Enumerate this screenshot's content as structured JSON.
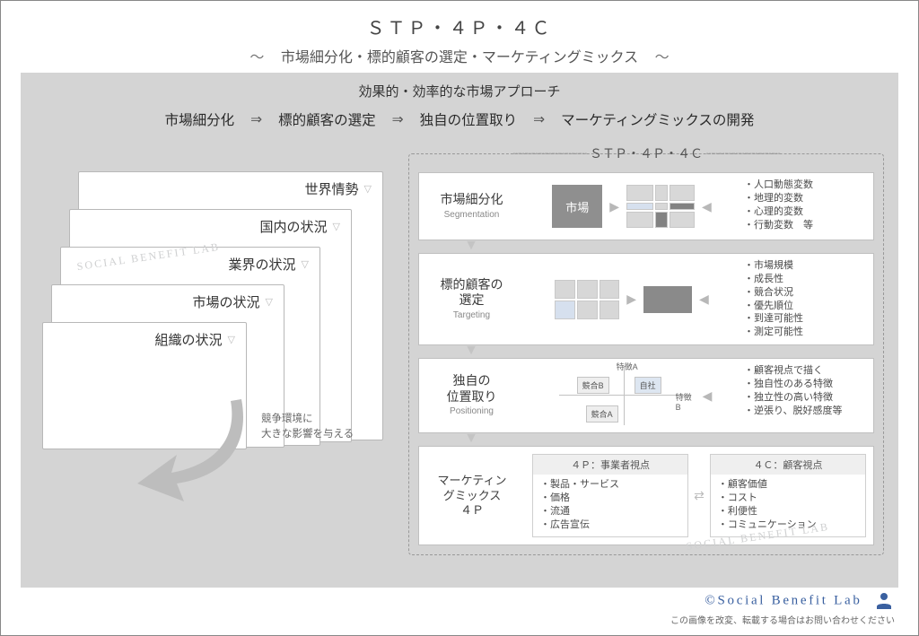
{
  "title": "ＳＴＰ・４Ｐ・４Ｃ",
  "subtitle": "市場細分化・標的顧客の選定・マーケティングミックス",
  "tilde": "〜",
  "topline": "効果的・効率的な市場アプローチ",
  "flow": {
    "a": "市場細分化",
    "b": "標的顧客の選定",
    "c": "独自の位置取り",
    "d": "マーケティングミックスの開発",
    "arr": "⇒"
  },
  "left": {
    "cards": [
      "世界情勢",
      "国内の状況",
      "業界の状況",
      "市場の状況",
      "組織の状況"
    ],
    "impact1": "競争環境に",
    "impact2": "大きな影響を与える",
    "wm": "SOCIAL BENEFIT LAB"
  },
  "right": {
    "label": "ＳＴＰ・４Ｐ・４Ｃ",
    "seg": {
      "jp": "市場細分化",
      "en": "Segmentation",
      "market": "市場",
      "bullets": [
        "人口動態変数",
        "地理的変数",
        "心理的変数",
        "行動変数　等"
      ]
    },
    "tar": {
      "jp1": "標的顧客の",
      "jp2": "選定",
      "en": "Targeting",
      "bullets": [
        "市場規模",
        "成長性",
        "競合状況",
        "優先順位",
        "到達可能性",
        "測定可能性"
      ]
    },
    "pos": {
      "jp1": "独自の",
      "jp2": "位置取り",
      "en": "Positioning",
      "axA": "特徴A",
      "axB": "特徴B",
      "self": "自社",
      "compA": "競合A",
      "compB": "競合B",
      "bullets": [
        "顧客視点で描く",
        "独自性のある特徴",
        "独立性の高い特徴",
        "逆張り、脱好感度等"
      ]
    },
    "mix": {
      "jp1": "マーケティン",
      "jp2": "グミックス",
      "jp3": "４Ｐ",
      "fourp_h": "４Ｐ：事業者視点",
      "fourc_h": "４Ｃ：顧客視点",
      "fourp": [
        "製品・サービス",
        "価格",
        "流通",
        "広告宣伝"
      ],
      "fourc": [
        "顧客価値",
        "コスト",
        "利便性",
        "コミュニケーション"
      ]
    },
    "wm": "SOCIAL BENEFIT LAB"
  },
  "footer": {
    "copy": "©Social Benefit Lab",
    "note": "この画像を改変、転載する場合はお問い合わせください"
  }
}
